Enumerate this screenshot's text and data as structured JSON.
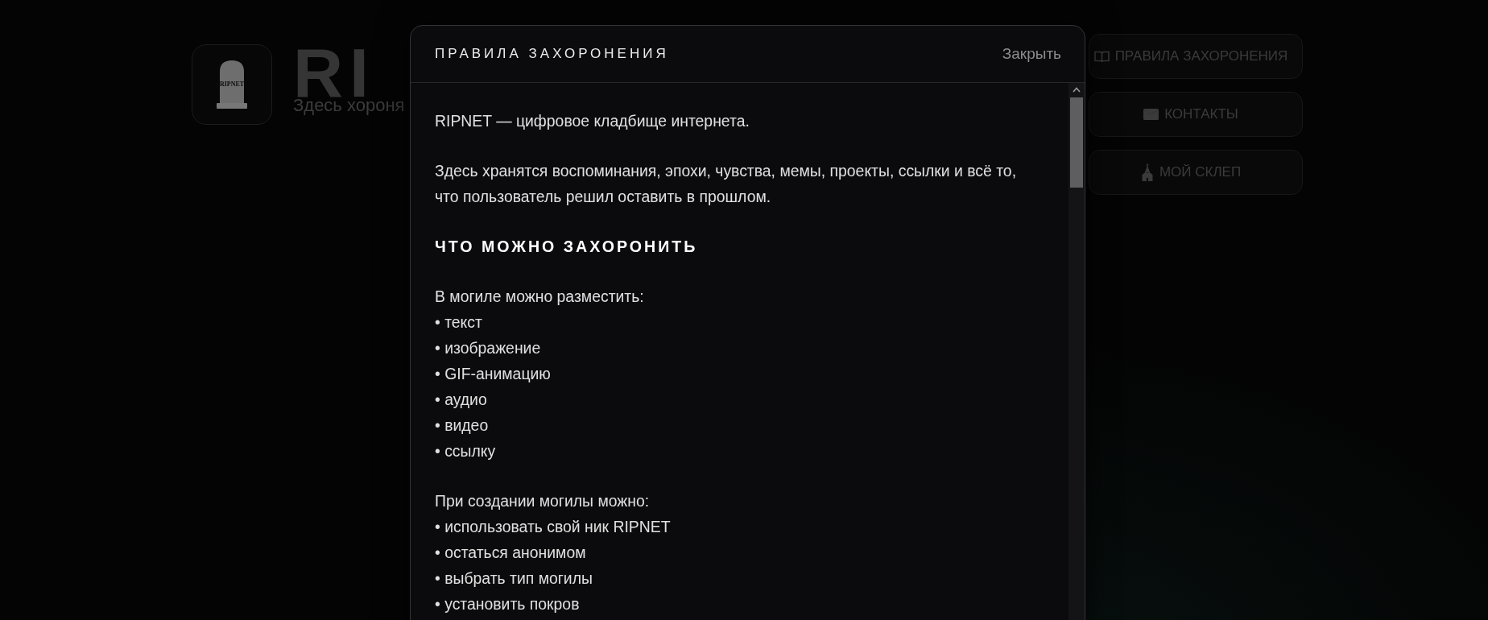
{
  "background": {
    "logo": {
      "inscription": "RIPNET"
    },
    "title": "RI",
    "subtitle": "Здесь хороня",
    "nav": [
      {
        "kind": "book",
        "label": "ПРАВИЛА ЗАХОРОНЕНИЯ"
      },
      {
        "kind": "envelope",
        "label": "КОНТАКТЫ"
      },
      {
        "kind": "church",
        "label": "МОЙ СКЛЕП"
      }
    ]
  },
  "modal": {
    "title": "ПРАВИЛА ЗАХОРОНЕНИЯ",
    "close_label": "Закрыть",
    "content": [
      {
        "kind": "paragraph",
        "text": "RIPNET — цифровое кладбище интернета."
      },
      {
        "kind": "paragraph",
        "text": "Здесь хранятся воспоминания, эпохи, чувства, мемы, проекты, ссылки и всё то, что пользователь решил оставить в прошлом."
      },
      {
        "kind": "heading",
        "text": "ЧТО МОЖНО ЗАХОРОНИТЬ"
      },
      {
        "kind": "list",
        "intro": "В могиле можно разместить:",
        "items": [
          "• текст",
          "• изображение",
          "• GIF-анимацию",
          "• аудио",
          "• видео",
          "• ссылку"
        ]
      },
      {
        "kind": "list",
        "intro": "При создании могилы можно:",
        "items": [
          "• использовать свой ник RIPNET",
          "• остаться анонимом",
          "• выбрать тип могилы",
          "• установить покров"
        ]
      }
    ]
  }
}
